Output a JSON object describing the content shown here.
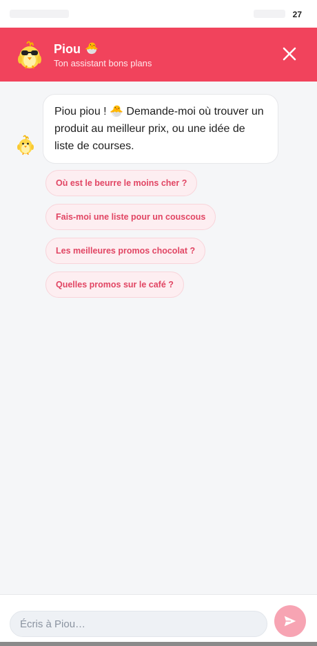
{
  "status_bar": {
    "time": "27"
  },
  "header": {
    "title": "Piou",
    "title_emoji": "🐣",
    "subtitle": "Ton assistant bons plans"
  },
  "chat": {
    "messages": [
      {
        "from": "bot",
        "text": "Piou piou ! 🐣 Demande-moi où trouver un produit au meilleur prix, ou une idée de liste de courses."
      }
    ],
    "suggestions": [
      "Où est le beurre le moins cher ?",
      "Fais-moi une liste pour un couscous",
      "Les meilleures promos chocolat ?",
      "Quelles promos sur le café ?"
    ]
  },
  "composer": {
    "placeholder": "Écris à Piou…"
  },
  "colors": {
    "brand": "#f1435c",
    "chip_text": "#e14563",
    "chip_bg": "#fdeef1",
    "send_button": "#f7a4b3"
  },
  "icons": {
    "header_avatar": "chick-sunglasses-icon",
    "bot_avatar": "chick-icon",
    "close": "close-icon",
    "send": "send-icon"
  }
}
